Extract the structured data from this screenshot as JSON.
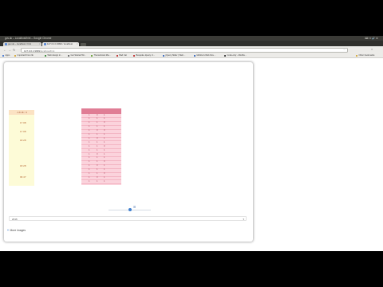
{
  "window": {
    "title": "gov.uk – Localhost/hint – Google Chrome"
  },
  "tabs": [
    {
      "label": "gov.uk – localhost / hint"
    },
    {
      "label": "127.0.0.1:9999 / localhost"
    }
  ],
  "toolbar": {
    "url_host": "127.0.0.1:9999",
    "url_path": "/localhost/hint"
  },
  "bookmarks": [
    {
      "label": "Apps",
      "color": "#4a7bd4"
    },
    {
      "label": "Imported From IE",
      "color": "#d4a93a"
    },
    {
      "label": "Web design in…",
      "color": "#3a8a3a"
    },
    {
      "label": "Get Started Wi…",
      "color": "#6a6a6a"
    },
    {
      "label": "Themeforest Ma…",
      "color": "#6aa13a"
    },
    {
      "label": "Bad Cat",
      "color": "#c03030"
    },
    {
      "label": "Bespoke Jquery U…",
      "color": "#c03030"
    },
    {
      "label": "jQuery Slider | Web…",
      "color": "#3a6ac0"
    },
    {
      "label": "Mobile & Web Dev…",
      "color": "#3a6ac0"
    },
    {
      "label": "Code-only - Mozilla…",
      "color": "#3a3a3a"
    },
    {
      "label": "Other bookmarks",
      "color": "#d4a93a"
    }
  ],
  "left_column": {
    "header": "· 4.8 18 ↑ 6",
    "values": [
      "17 08",
      "17 08",
      "18 28",
      "18 28",
      "09 47"
    ]
  },
  "mid_table": {
    "rows": [
      [
        "1",
        "0",
        "1"
      ],
      [
        "1",
        "1",
        "1"
      ],
      [
        "1",
        "1",
        "0"
      ],
      [
        "1",
        "1",
        "1"
      ],
      [
        "1",
        "0",
        "0"
      ],
      [
        "1",
        "1",
        "1"
      ],
      [
        "1",
        "0",
        "1"
      ],
      [
        "1",
        "1",
        "1"
      ],
      [
        "1",
        "1",
        "0"
      ],
      [
        "1",
        "1",
        "1"
      ],
      [
        "1",
        "0",
        "1"
      ],
      [
        "1",
        "1",
        "1"
      ],
      [
        "1",
        "1",
        "0"
      ],
      [
        "1",
        "0",
        "1"
      ],
      [
        "1",
        "1",
        "1"
      ],
      [
        "1",
        "1",
        "0"
      ],
      [
        "1",
        "0",
        "1"
      ],
      [
        "1",
        "1",
        "1"
      ]
    ]
  },
  "slider": {
    "value": 0.5
  },
  "dropdown": {
    "selected": "2016"
  },
  "more_images": {
    "label": "More images"
  }
}
